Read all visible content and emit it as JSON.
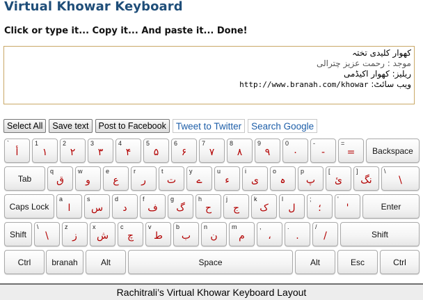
{
  "page": {
    "title": "Virtual Khowar Keyboard",
    "subtitle": "Click or type it... Copy it... And paste it... Done!"
  },
  "textarea": {
    "line1": "کھوار کلیدی تختہ",
    "line2": "موجد : رحمت عزیز چترالی",
    "line3": "ریلیز: کھوار اکیڈمی",
    "line4_prefix": "ویب سائٹ: ",
    "link": "http://www.branah.com/khowar"
  },
  "actions": {
    "select_all": "Select All",
    "save_text": "Save text",
    "post_facebook": "Post to Facebook",
    "tweet": "Tweet to Twitter",
    "search_google": "Search Google"
  },
  "keyboard": {
    "row1": [
      {
        "en": "`",
        "ar": "أ"
      },
      {
        "en": "1",
        "ar": "١"
      },
      {
        "en": "2",
        "ar": "٢"
      },
      {
        "en": "3",
        "ar": "٣"
      },
      {
        "en": "4",
        "ar": "۴"
      },
      {
        "en": "5",
        "ar": "۵"
      },
      {
        "en": "6",
        "ar": "۶"
      },
      {
        "en": "7",
        "ar": "٧"
      },
      {
        "en": "8",
        "ar": "٨"
      },
      {
        "en": "9",
        "ar": "٩"
      },
      {
        "en": "0",
        "ar": "٠"
      },
      {
        "en": "-",
        "ar": "-"
      },
      {
        "en": "=",
        "ar": "="
      }
    ],
    "backspace": "Backspace",
    "tab": "Tab",
    "row2": [
      {
        "en": "q",
        "ar": "ق"
      },
      {
        "en": "w",
        "ar": "و"
      },
      {
        "en": "e",
        "ar": "ع"
      },
      {
        "en": "r",
        "ar": "ر"
      },
      {
        "en": "t",
        "ar": "ت"
      },
      {
        "en": "y",
        "ar": "ے"
      },
      {
        "en": "u",
        "ar": "ء"
      },
      {
        "en": "i",
        "ar": "ی"
      },
      {
        "en": "o",
        "ar": "ہ"
      },
      {
        "en": "p",
        "ar": "پ"
      },
      {
        "en": "[",
        "ar": "ئ"
      },
      {
        "en": "]",
        "ar": "نگ"
      },
      {
        "en": "\\",
        "ar": "\\"
      }
    ],
    "caps": "Caps Lock",
    "row3": [
      {
        "en": "a",
        "ar": "ا"
      },
      {
        "en": "s",
        "ar": "س"
      },
      {
        "en": "d",
        "ar": "د"
      },
      {
        "en": "f",
        "ar": "ف"
      },
      {
        "en": "g",
        "ar": "گ"
      },
      {
        "en": "h",
        "ar": "ح"
      },
      {
        "en": "j",
        "ar": "ج"
      },
      {
        "en": "k",
        "ar": "ک"
      },
      {
        "en": "l",
        "ar": "ل"
      },
      {
        "en": ";",
        "ar": "؛"
      },
      {
        "en": "'",
        "ar": "'"
      }
    ],
    "enter": "Enter",
    "shift": "Shift",
    "row4": [
      {
        "en": "\\",
        "ar": "\\"
      },
      {
        "en": "z",
        "ar": "ز"
      },
      {
        "en": "x",
        "ar": "ش"
      },
      {
        "en": "c",
        "ar": "چ"
      },
      {
        "en": "v",
        "ar": "ط"
      },
      {
        "en": "b",
        "ar": "ب"
      },
      {
        "en": "n",
        "ar": "ن"
      },
      {
        "en": "m",
        "ar": "م"
      },
      {
        "en": ",",
        "ar": "،"
      },
      {
        "en": ".",
        "ar": "."
      },
      {
        "en": "/",
        "ar": "/"
      }
    ],
    "ctrl": "Ctrl",
    "branah": "branah",
    "alt": "Alt",
    "space": "Space",
    "esc": "Esc"
  },
  "footer": {
    "caption": "Rachitrali’s Virtual Khowar Keyboard Layout"
  }
}
